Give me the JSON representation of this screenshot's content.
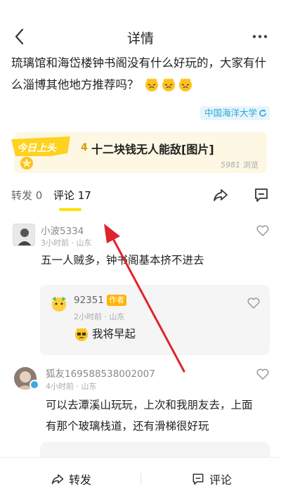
{
  "nav": {
    "title": "详情"
  },
  "post": {
    "text": "琉璃馆和海岱楼钟书阁没有什么好玩的，大家有什么淄博其他地方推荐吗？",
    "tag": "中国海洋大学"
  },
  "hot": {
    "badge_text": "今日上头",
    "rank": "4",
    "title": "十二块钱无人能敌[图片]",
    "views": "5981",
    "views_label": "浏览"
  },
  "tabs": {
    "repost": "转发 0",
    "comment": "评论 17"
  },
  "comments": [
    {
      "user": "小波5334",
      "meta": "3小时前 · 山东",
      "text": "五一人贼多，钟书阁基本挤不进去",
      "reply": {
        "user": "92351",
        "author_tag": "作者",
        "meta": "2小时前 · 山东",
        "text": "我将早起"
      }
    },
    {
      "user": "狐友169588538002007",
      "meta": "4小时前 · 山东",
      "text_line1": "可以去潭溪山玩玩，上次和我朋友去，上面",
      "text_line2": "有那个玻璃栈道，还有滑梯很好玩"
    }
  ],
  "bottom": {
    "repost": "转发",
    "comment": "评论"
  },
  "colors": {
    "accent": "#ffe000",
    "annotation": "#e0232b",
    "tag": "#2aa8d8"
  }
}
